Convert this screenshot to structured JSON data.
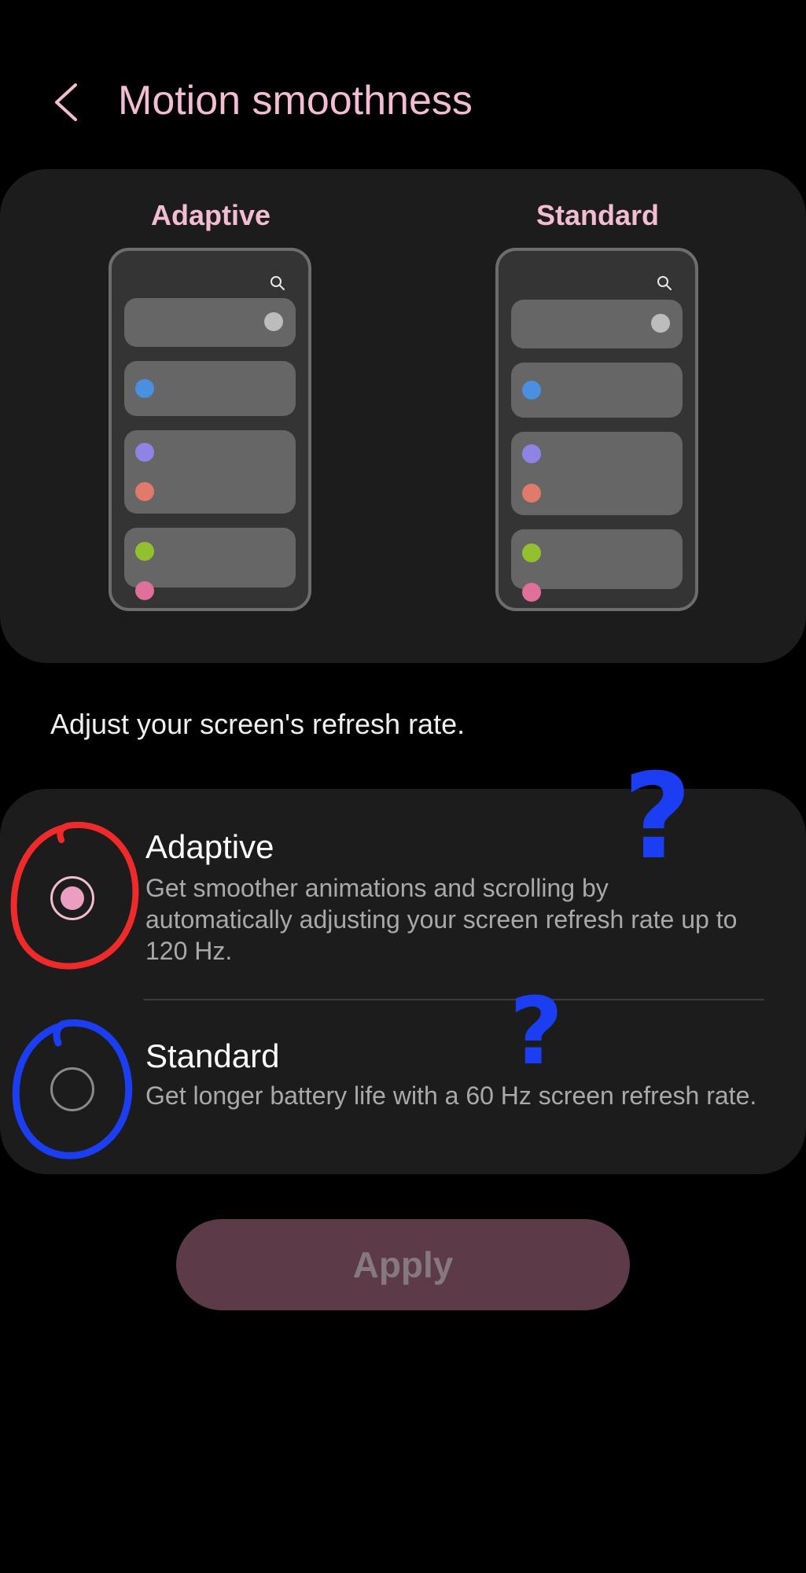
{
  "header": {
    "back_icon": "chevron-left-icon",
    "title": "Motion smoothness"
  },
  "preview": {
    "left_label": "Adaptive",
    "right_label": "Standard",
    "dot_colors": [
      "#bcbcbc",
      "#4a8fe0",
      "#8f84e6",
      "#e07a6b",
      "#93c02e",
      "#e06f9a"
    ]
  },
  "description": "Adjust your screen's refresh rate.",
  "options": [
    {
      "title": "Adaptive",
      "subtitle": "Get smoother animations and scrolling by automatically adjusting your screen refresh rate up to 120 Hz.",
      "selected": true
    },
    {
      "title": "Standard",
      "subtitle": "Get longer battery life with a 60 Hz screen refresh rate.",
      "selected": false
    }
  ],
  "apply_label": "Apply",
  "annotation": {
    "question_mark": "?",
    "circle_color_selected": "#f02a2a",
    "circle_color_unselected": "#1b3ef2"
  },
  "colors": {
    "accent": "#f2bcd2",
    "card": "#1c1c1c",
    "apply_bg": "#5c3a47"
  }
}
